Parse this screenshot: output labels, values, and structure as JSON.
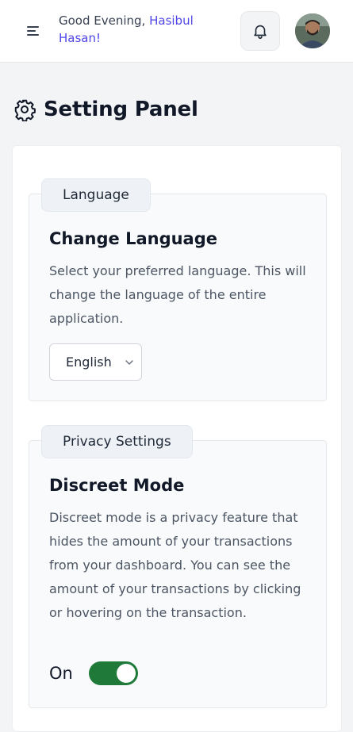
{
  "header": {
    "greeting_prefix": "Good Evening, ",
    "user_name": "Hasibul Hasan!",
    "icons": {
      "menu": "menu-icon",
      "bell": "bell-icon",
      "avatar": "avatar"
    }
  },
  "page": {
    "title": "Setting Panel",
    "icon": "gear-icon"
  },
  "language_section": {
    "tag": "Language",
    "heading": "Change Language",
    "description": "Select your preferred language. This will change the language of the entire application.",
    "select_value": "English"
  },
  "privacy_section": {
    "tag": "Privacy Settings",
    "heading": "Discreet Mode",
    "description": "Discreet mode is a privacy feature that hides the amount of your transactions from your dashboard. You can see the amount of your transactions by clicking or hovering on the transaction.",
    "toggle_label": "On",
    "toggle_on": true
  },
  "colors": {
    "accent": "#4f46e5",
    "toggle_on": "#1f7a3a"
  }
}
